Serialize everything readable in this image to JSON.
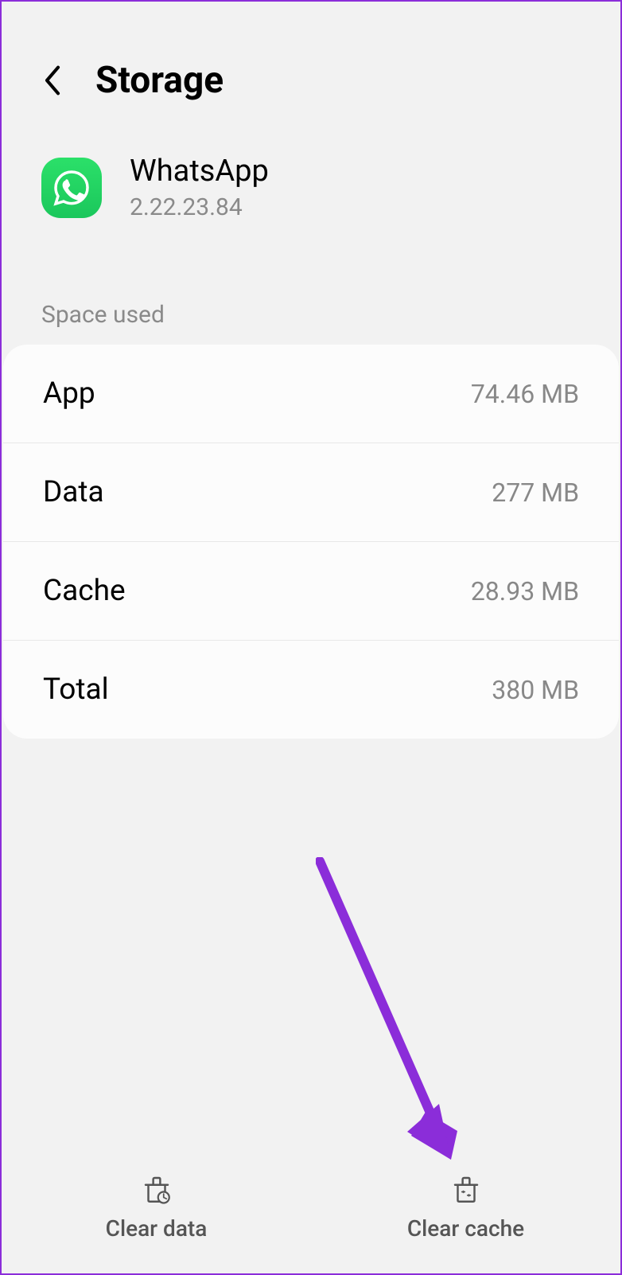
{
  "header": {
    "title": "Storage"
  },
  "app": {
    "name": "WhatsApp",
    "version": "2.22.23.84",
    "icon": "whatsapp-icon"
  },
  "section": {
    "label": "Space used"
  },
  "storage": {
    "rows": [
      {
        "label": "App",
        "value": "74.46 MB"
      },
      {
        "label": "Data",
        "value": "277 MB"
      },
      {
        "label": "Cache",
        "value": "28.93 MB"
      },
      {
        "label": "Total",
        "value": "380 MB"
      }
    ]
  },
  "actions": {
    "clear_data": "Clear data",
    "clear_cache": "Clear cache"
  },
  "annotation": {
    "arrow_color": "#8b2dd9"
  }
}
